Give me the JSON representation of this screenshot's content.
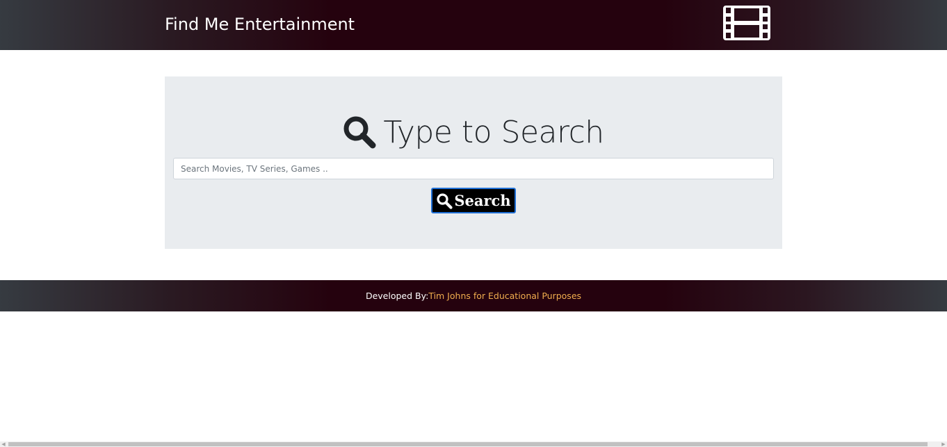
{
  "navbar": {
    "brand": "Find Me Entertainment",
    "icon": "film-icon"
  },
  "search": {
    "heading": "Type to Search",
    "heading_icon": "search-icon",
    "placeholder": "Search Movies, TV Series, Games ..",
    "value": "",
    "button_label": "Search",
    "button_icon": "search-icon"
  },
  "footer": {
    "label": "Developed By:",
    "credit": "Tim Johns for Educational Purposes"
  },
  "colors": {
    "header_bg": "#25020e",
    "jumbotron_bg": "#e9ecef",
    "button_bg": "#000000",
    "button_border": "#1f6fd6",
    "credit_color": "#f0ad4e"
  }
}
